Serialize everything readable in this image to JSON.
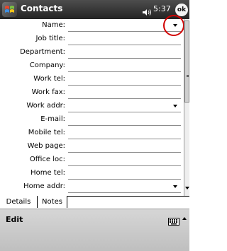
{
  "title_bar": {
    "app_title": "Contacts",
    "time": "5:37",
    "ok_label": "ok"
  },
  "form": {
    "fields": [
      {
        "label": "Name:",
        "dropdown": true
      },
      {
        "label": "Job title:",
        "dropdown": false
      },
      {
        "label": "Department:",
        "dropdown": false
      },
      {
        "label": "Company:",
        "dropdown": false
      },
      {
        "label": "Work tel:",
        "dropdown": false
      },
      {
        "label": "Work fax:",
        "dropdown": false
      },
      {
        "label": "Work addr:",
        "dropdown": true
      },
      {
        "label": "E-mail:",
        "dropdown": false
      },
      {
        "label": "Mobile tel:",
        "dropdown": false
      },
      {
        "label": "Web page:",
        "dropdown": false
      },
      {
        "label": "Office loc:",
        "dropdown": false
      },
      {
        "label": "Home tel:",
        "dropdown": false
      },
      {
        "label": "Home addr:",
        "dropdown": true
      }
    ]
  },
  "tabs": [
    {
      "label": "Details",
      "selected": true
    },
    {
      "label": "Notes",
      "selected": false
    }
  ],
  "menu": {
    "edit_label": "Edit"
  },
  "icons": {
    "start": "windows-flag-icon",
    "volume": "speaker-icon",
    "input_panel": "keyboard-icon"
  },
  "colors": {
    "titlebar": "#2d2d2d",
    "annotation_circle": "#d10000",
    "menubar": "#c8c8c8"
  }
}
